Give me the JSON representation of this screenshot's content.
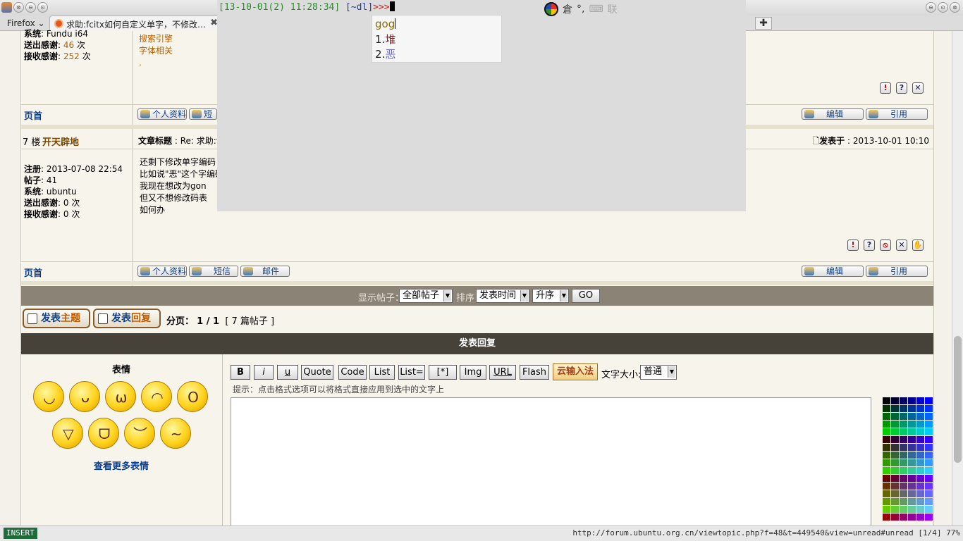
{
  "browser": {
    "menu_label": "Firefox",
    "tab_title": "求助:fcitx如何自定义单字，不修改…",
    "tab_close": "✖",
    "newtab_label": "✚"
  },
  "window": {
    "btn_min": "⊖",
    "btn_max": "⊙",
    "btn_close": "⊗"
  },
  "post6": {
    "profile": {
      "system_label": "系统",
      "system_value": "Fundu i64",
      "thanks_sent_label": "送出感谢",
      "thanks_sent_value": "46",
      "thanks_recv_label": "接收感谢",
      "thanks_recv_value": "252",
      "times_unit": "次"
    },
    "links": [
      "搜索引擎",
      "字体相关",
      "."
    ],
    "top_link": "页首",
    "buttons": {
      "profile": "个人资料",
      "pm": "短"
    },
    "edit": "编辑",
    "quote": "引用"
  },
  "post7": {
    "floor": "7 楼",
    "author": "开天辟地",
    "subject_label": "文章标题",
    "subject_value": "Re: 求助:f",
    "posted_label": "发表于",
    "posted_value": "2013-10-01 10:10",
    "profile": {
      "reg_label": "注册",
      "reg_value": "2013-07-08 22:54",
      "posts_label": "帖子",
      "posts_value": "41",
      "system_label": "系统",
      "system_value": "ubuntu",
      "thanks_sent_label": "送出感谢",
      "thanks_sent_value": "0",
      "thanks_recv_label": "接收感谢",
      "thanks_recv_value": "0",
      "times_unit": "次"
    },
    "body": [
      "还剩下修改单字编码",
      "比如说\"恶\"这个字编码",
      "我现在想改为gon",
      "但又不想修改码表",
      "如何办"
    ],
    "top_link": "页首",
    "buttons": {
      "profile": "个人资料",
      "pm": "短信",
      "email": "邮件"
    },
    "edit": "编辑",
    "quote": "引用"
  },
  "filter": {
    "show_label": "显示帖子：",
    "show_value": "全部帖子",
    "sort_label": "排序",
    "sort_value": "发表时间",
    "order_value": "升序",
    "go": "GO"
  },
  "actions": {
    "new_topic_a": "发表",
    "new_topic_b": "主题",
    "reply_a": "发表",
    "reply_b": "回复",
    "pager_label": "分页：",
    "pager_value": "1 / 1",
    "post_count": "[ 7 篇帖子 ]"
  },
  "reply": {
    "header": "发表回复",
    "smilies_title": "表情",
    "more_smilies": "查看更多表情",
    "smiley_faces": [
      "◡",
      "ᴗ",
      "ω",
      "◠",
      "O",
      "▽",
      "ᗜ",
      "︶",
      "~"
    ],
    "format_buttons": [
      "B",
      "i",
      "u",
      "Quote",
      "Code",
      "List",
      "List=",
      "[*]",
      "Img",
      "URL",
      "Flash"
    ],
    "cloud_ime": "云输入法",
    "font_size_label": "文字大小:",
    "font_size_value": "普通",
    "hint": "提示：点击格式选项可以将格式直接应用到选中的文字上"
  },
  "console": {
    "datetime": "[13-10-01(2) 11:28:34]",
    "path": "[~dl]",
    "prompt": ">>>",
    "ime_name": "倉",
    "ime_punct": "°,",
    "ime_kbd": "⌨",
    "ime_mode": "联"
  },
  "candidates": {
    "input": "gog",
    "items": [
      {
        "index": "1.",
        "text": "堆"
      },
      {
        "index": "2.",
        "text": "恶"
      }
    ]
  },
  "statusbar": {
    "mode": "INSERT",
    "url": "http://forum.ubuntu.org.cn/viewtopic.php?f=48&t=449540&view=unread#unread [1/4] 77%"
  },
  "palette_colors": [
    "#000000",
    "#000033",
    "#000066",
    "#000099",
    "#0000cc",
    "#0000ff",
    "#003300",
    "#003333",
    "#003366",
    "#003399",
    "#0033cc",
    "#0033ff",
    "#006600",
    "#006633",
    "#006666",
    "#006699",
    "#0066cc",
    "#0066ff",
    "#009900",
    "#009933",
    "#009966",
    "#009999",
    "#0099cc",
    "#0099ff",
    "#00cc00",
    "#00cc33",
    "#00cc66",
    "#00cc99",
    "#00cccc",
    "#00ccff",
    "#330000",
    "#330033",
    "#330066",
    "#330099",
    "#3300cc",
    "#3300ff",
    "#333300",
    "#333333",
    "#333366",
    "#333399",
    "#3333cc",
    "#3333ff",
    "#336600",
    "#336633",
    "#336666",
    "#336699",
    "#3366cc",
    "#3366ff",
    "#339900",
    "#339933",
    "#339966",
    "#339999",
    "#3399cc",
    "#3399ff",
    "#33cc00",
    "#33cc33",
    "#33cc66",
    "#33cc99",
    "#33cccc",
    "#33ccff",
    "#660000",
    "#660033",
    "#660066",
    "#660099",
    "#6600cc",
    "#6600ff",
    "#663300",
    "#663333",
    "#663366",
    "#663399",
    "#6633cc",
    "#6633ff",
    "#666600",
    "#666633",
    "#666666",
    "#666699",
    "#6666cc",
    "#6666ff",
    "#669900",
    "#669933",
    "#669966",
    "#669999",
    "#6699cc",
    "#6699ff",
    "#66cc00",
    "#66cc33",
    "#66cc66",
    "#66cc99",
    "#66cccc",
    "#66ccff",
    "#990000",
    "#990033",
    "#990066",
    "#990099",
    "#9900cc",
    "#9900ff"
  ]
}
